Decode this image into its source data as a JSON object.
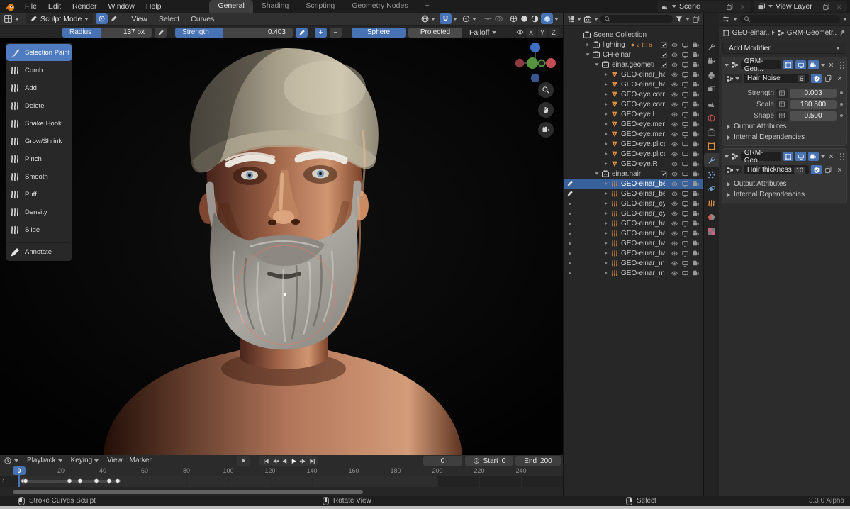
{
  "colors": {
    "accent": "#4772b3",
    "object_orange": "#dd8d3e",
    "selection": "#38619b"
  },
  "topbar": {
    "menus": [
      "File",
      "Edit",
      "Render",
      "Window",
      "Help"
    ],
    "workspaces": [
      {
        "label": "General",
        "active": true
      },
      {
        "label": "Shading"
      },
      {
        "label": "Scripting"
      },
      {
        "label": "Geometry Nodes"
      },
      {
        "label": "+"
      }
    ],
    "scene": {
      "label": "Scene"
    },
    "view_layer": {
      "label": "View Layer"
    }
  },
  "viewport": {
    "mode_label": "Sculpt Mode",
    "menus": [
      "View",
      "Select",
      "Curves"
    ],
    "mirror_axes": [
      "X",
      "Y",
      "Z"
    ]
  },
  "tool_settings": {
    "radius_label": "Radius",
    "radius_value": "137 px",
    "strength_label": "Strength",
    "strength_value": "0.403",
    "plus_label": "+",
    "minus_label": "−",
    "sphere_label": "Sphere",
    "projected_label": "Projected",
    "falloff_label": "Falloff"
  },
  "tools": [
    {
      "label": "Selection Paint",
      "icon": "selection-paint",
      "glyph": "brush",
      "active": true
    },
    {
      "label": "Comb",
      "icon": "comb",
      "glyph": "squiggle"
    },
    {
      "label": "Add",
      "icon": "add",
      "glyph": "squiggle"
    },
    {
      "label": "Delete",
      "icon": "delete",
      "glyph": "squiggle"
    },
    {
      "label": "Snake Hook",
      "icon": "snake-hook",
      "glyph": "squiggle"
    },
    {
      "label": "Grow/Shrink",
      "icon": "grow-shrink",
      "glyph": "squiggle"
    },
    {
      "label": "Pinch",
      "icon": "pinch",
      "glyph": "squiggle"
    },
    {
      "label": "Smooth",
      "icon": "smooth",
      "glyph": "squiggle"
    },
    {
      "label": "Puff",
      "icon": "puff",
      "glyph": "squiggle"
    },
    {
      "label": "Density",
      "icon": "density",
      "glyph": "squiggle"
    },
    {
      "label": "Slide",
      "icon": "slide",
      "glyph": "squiggle"
    },
    {
      "label": "Annotate",
      "icon": "annotate",
      "glyph": "pen",
      "separated": true
    }
  ],
  "outliner": {
    "rows": [
      {
        "label": "Scene Collection",
        "type": "collection",
        "indent": 0
      },
      {
        "label": "lighting",
        "type": "collection",
        "indent": 1,
        "expanded": "closed",
        "checkbox": true,
        "toggles": true,
        "extra1": "2",
        "extra2": "6"
      },
      {
        "label": "CH-einar",
        "type": "collection",
        "indent": 1,
        "expanded": "open",
        "checkbox": true,
        "toggles": true
      },
      {
        "label": "einar.geometry",
        "type": "collection",
        "indent": 2,
        "expanded": "open",
        "checkbox": true,
        "toggles": true
      },
      {
        "label": "GEO-einar_hat",
        "type": "mesh",
        "indent": 3,
        "expanded": "closed",
        "toggles": true
      },
      {
        "label": "GEO-einar_heac",
        "type": "mesh",
        "indent": 3,
        "expanded": "closed",
        "toggles": true
      },
      {
        "label": "GEO-eye.cornea",
        "type": "mesh",
        "indent": 3,
        "expanded": "closed",
        "toggles": true
      },
      {
        "label": "GEO-eye.cornea",
        "type": "mesh",
        "indent": 3,
        "expanded": "closed",
        "toggles": true
      },
      {
        "label": "GEO-eye.L",
        "type": "mesh",
        "indent": 3,
        "expanded": "closed",
        "toggles": true
      },
      {
        "label": "GEO-eye.menisc",
        "type": "mesh",
        "indent": 3,
        "expanded": "closed",
        "toggles": true
      },
      {
        "label": "GEO-eye.menisc",
        "type": "mesh",
        "indent": 3,
        "expanded": "closed",
        "toggles": true
      },
      {
        "label": "GEO-eye.plica_s",
        "type": "mesh",
        "indent": 3,
        "expanded": "closed",
        "toggles": true
      },
      {
        "label": "GEO-eye.plica_s",
        "type": "mesh",
        "indent": 3,
        "expanded": "closed",
        "toggles": true
      },
      {
        "label": "GEO-eye.R",
        "type": "mesh",
        "indent": 3,
        "expanded": "closed",
        "toggles": true
      },
      {
        "label": "einar.hair",
        "type": "collection",
        "indent": 2,
        "expanded": "open",
        "checkbox": true,
        "toggles": true
      },
      {
        "label": "GEO-einar_bear",
        "type": "curves",
        "indent": 3,
        "expanded": "closed",
        "toggles": true,
        "selected": true,
        "gutter": "pen"
      },
      {
        "label": "GEO-einar_bear",
        "type": "curves",
        "indent": 3,
        "expanded": "closed",
        "toggles": true,
        "gutter": "pen"
      },
      {
        "label": "GEO-einar_eyeb",
        "type": "curves",
        "indent": 3,
        "expanded": "closed",
        "toggles": true,
        "gutter": "dot"
      },
      {
        "label": "GEO-einar_eyel",
        "type": "curves",
        "indent": 3,
        "expanded": "closed",
        "toggles": true,
        "gutter": "dot"
      },
      {
        "label": "GEO-einar_hair",
        "type": "curves",
        "indent": 3,
        "expanded": "closed",
        "toggles": true,
        "gutter": "dot"
      },
      {
        "label": "GEO-einar_hair.",
        "type": "curves",
        "indent": 3,
        "expanded": "closed",
        "toggles": true,
        "gutter": "dot"
      },
      {
        "label": "GEO-einar_hair_",
        "type": "curves",
        "indent": 3,
        "expanded": "closed",
        "toggles": true,
        "gutter": "dot"
      },
      {
        "label": "GEO-einar_hair_",
        "type": "curves",
        "indent": 3,
        "expanded": "closed",
        "toggles": true,
        "gutter": "dot"
      },
      {
        "label": "GEO-einar_must",
        "type": "curves",
        "indent": 3,
        "expanded": "closed",
        "toggles": true,
        "gutter": "dot"
      },
      {
        "label": "GEO-einar_must",
        "type": "curves",
        "indent": 3,
        "expanded": "closed",
        "toggles": true,
        "gutter": "dot"
      }
    ]
  },
  "properties": {
    "tabs": [
      "tool",
      "render",
      "output",
      "view-layer",
      "scene",
      "world",
      "collection",
      "object",
      "modifiers",
      "particles",
      "physics",
      "object-data",
      "material",
      "texture"
    ],
    "active_tab": "modifiers",
    "breadcrumb_object": "GEO-einar...",
    "breadcrumb_nodetree": "GRM-Geometr...",
    "add_modifier_label": "Add Modifier",
    "modifiers": [
      {
        "name": "GRM-Geo...",
        "node_group": "Hair Noise",
        "users": "6",
        "fields": [
          {
            "label": "Strength",
            "value": "0.003"
          },
          {
            "label": "Scale",
            "value": "180.500"
          },
          {
            "label": "Shape",
            "value": "0.500"
          }
        ],
        "sections": [
          "Output Attributes",
          "Internal Dependencies"
        ]
      },
      {
        "name": "GRM-Geo...",
        "node_group": "Hair thickness",
        "users": "10",
        "fields": [],
        "sections": [
          "Output Attributes",
          "Internal Dependencies"
        ]
      }
    ]
  },
  "timeline": {
    "menus": [
      {
        "label": "Playback",
        "caret": true
      },
      {
        "label": "Keying",
        "caret": true
      },
      {
        "label": "View"
      },
      {
        "label": "Marker"
      }
    ],
    "ticks": [
      0,
      20,
      40,
      60,
      80,
      100,
      120,
      140,
      160,
      180,
      200,
      220,
      240
    ],
    "keyframes": [
      2,
      3,
      24,
      29,
      37,
      43,
      47
    ],
    "current_frame": "0",
    "start_label": "Start",
    "start_value": "0",
    "end_label": "End",
    "end_value": "200"
  },
  "status_bar": {
    "hints": [
      {
        "button": "left",
        "label": "Stroke Curves Sculpt"
      },
      {
        "button": "middle",
        "label": "Rotate View"
      },
      {
        "button": "right",
        "label": "Select"
      }
    ],
    "version": "3.3.0 Alpha"
  }
}
